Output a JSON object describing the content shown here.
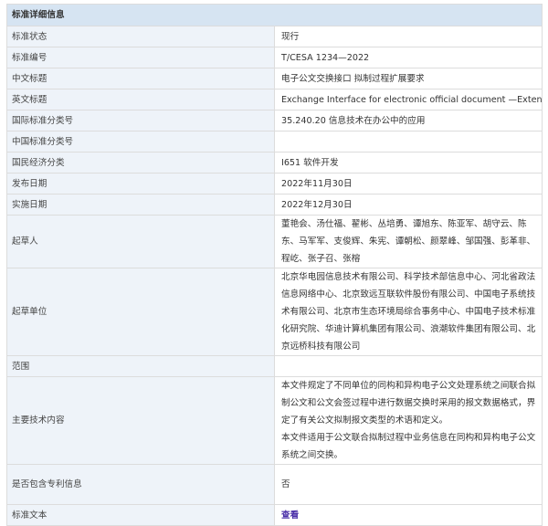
{
  "header": {
    "title": "标准详细信息"
  },
  "rows": [
    {
      "label": "标准状态",
      "value": "现行"
    },
    {
      "label": "标准编号",
      "value": "T/CESA 1234—2022"
    },
    {
      "label": "中文标题",
      "value": "电子公文交换接口 拟制过程扩展要求"
    },
    {
      "label": "英文标题",
      "value": "Exchange Interface for electronic official document —Extension requirements for drafting process"
    },
    {
      "label": "国际标准分类号",
      "value": "35.240.20 信息技术在办公中的应用"
    },
    {
      "label": "中国标准分类号",
      "value": ""
    },
    {
      "label": "国民经济分类",
      "value": "I651 软件开发"
    },
    {
      "label": "发布日期",
      "value": "2022年11月30日"
    },
    {
      "label": "实施日期",
      "value": "2022年12月30日"
    },
    {
      "label": "起草人",
      "value": "董艳会、汤仕福、翟彬、丛培勇、谭旭东、陈亚军、胡守云、陈东、马军军、支俊辉、朱宪、谭朝松、颜翠峰、邹国强、彭革非、程屹、张子召、张榕"
    },
    {
      "label": "起草单位",
      "value": "北京华电园信息技术有限公司、科学技术部信息中心、河北省政法信息网络中心、北京致远互联软件股份有限公司、中国电子系统技术有限公司、北京市生态环境局综合事务中心、中国电子技术标准化研究院、华迪计算机集团有限公司、浪潮软件集团有限公司、北京远桥科技有限公司"
    },
    {
      "label": "范围",
      "value": ""
    },
    {
      "label": "主要技术内容",
      "value_lines": [
        "本文件规定了不同单位的同构和异构电子公文处理系统之间联合拟制公文和公文会签过程中进行数据交换时采用的报文数据格式，界定了有关公文拟制报文类型的术语和定义。",
        "本文件适用于公文联合拟制过程中业务信息在同构和异构电子公文系统之间交换。"
      ]
    },
    {
      "label": "是否包含专利信息",
      "value": "否"
    },
    {
      "label": "标准文本",
      "value": "查看"
    }
  ]
}
